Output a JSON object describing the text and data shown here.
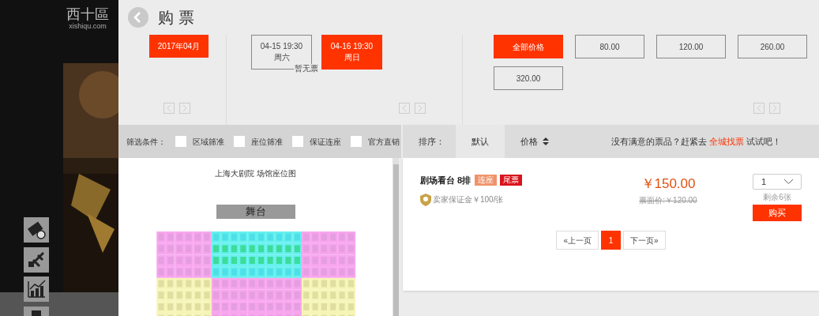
{
  "logo": {
    "name": "西十區",
    "domain": "xishiqu.com"
  },
  "header": {
    "title": "购 票"
  },
  "months": [
    {
      "label": "2017年04月",
      "selected": true
    }
  ],
  "sessions": [
    {
      "date": "04-15 19:30",
      "weekday": "周六",
      "selected": false,
      "note": "暂无票"
    },
    {
      "date": "04-16 19:30",
      "weekday": "周日",
      "selected": true
    }
  ],
  "prices": [
    {
      "label": "全部价格",
      "selected": true
    },
    {
      "label": "80.00",
      "selected": false
    },
    {
      "label": "120.00",
      "selected": false
    },
    {
      "label": "260.00",
      "selected": false
    },
    {
      "label": "320.00",
      "selected": false
    }
  ],
  "filter": {
    "label": "筛选条件：",
    "options": [
      {
        "label": "区域筛准",
        "checked": false
      },
      {
        "label": "座位筛准",
        "checked": false
      },
      {
        "label": "保证连座",
        "checked": false
      },
      {
        "label": "官方直销",
        "checked": false
      }
    ]
  },
  "sort": {
    "label": "排序：",
    "options": [
      {
        "label": "默认",
        "selected": true,
        "kind": "plain"
      },
      {
        "label": "价格",
        "selected": false,
        "kind": "sortable"
      }
    ],
    "hint": {
      "before": "没有满意的票品？赶紧去",
      "link": "全城找票",
      "after": "试试吧！"
    }
  },
  "seat_map": {
    "title": "上海大剧院 场馆座位图",
    "stage": "舞台"
  },
  "listings": [
    {
      "name": "剧场看台 8排",
      "tags": [
        {
          "label": "连座",
          "color": "#f0936a"
        },
        {
          "label": "尾票",
          "color": "#d9141c"
        }
      ],
      "guarantee": "卖家保证金￥100/张",
      "price": "￥150.00",
      "face_value": "票面价:￥120.00",
      "quantity": "1",
      "remaining": "剩余6张",
      "buy": "购买"
    }
  ],
  "pagination": {
    "prev": "«上一页",
    "pages": [
      {
        "label": "1",
        "selected": true
      }
    ],
    "next": "下一页»"
  }
}
